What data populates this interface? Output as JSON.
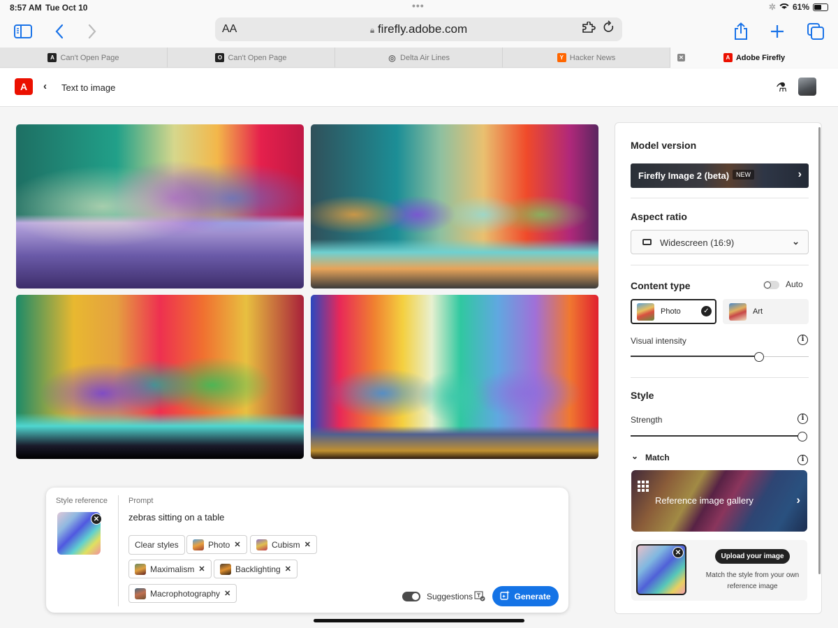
{
  "status": {
    "time": "8:57 AM",
    "date": "Tue Oct 10",
    "battery": "61%",
    "battery_level": 0.61
  },
  "browser": {
    "aa_label": "AA",
    "url": "firefly.adobe.com",
    "tabs": [
      {
        "label": "Can't Open Page",
        "favicon": "A",
        "favicon_color": "#222222"
      },
      {
        "label": "Can't Open Page",
        "favicon": "O",
        "favicon_color": "#222222"
      },
      {
        "label": "Delta Air Lines",
        "favicon": "◎",
        "favicon_color": "#777777"
      },
      {
        "label": "Hacker News",
        "favicon": "Y",
        "favicon_color": "#ff6600"
      },
      {
        "label": "Adobe Firefly",
        "favicon": "A",
        "favicon_color": "#eb1000",
        "active": true
      }
    ]
  },
  "app": {
    "title": "Text to image",
    "logo": "A",
    "brand_color": "#eb1000",
    "accent_color": "#1473e6"
  },
  "images": [
    {
      "alt": "Prismatic paper zebras on a table, teal and red background"
    },
    {
      "alt": "Four origami glass animals with rainbow background"
    },
    {
      "alt": "Holographic zebras on a round reflective table"
    },
    {
      "alt": "Paper zebras in front of a rainbow light curtain"
    }
  ],
  "prompt_bar": {
    "style_reference_label": "Style reference",
    "prompt_label": "Prompt",
    "prompt_text": "zebras sitting on a table",
    "clear_styles": "Clear styles",
    "chips": [
      "Photo",
      "Cubism",
      "Maximalism",
      "Backlighting",
      "Macrophotography"
    ],
    "suggestions_label": "Suggestions",
    "suggestions_on": true,
    "generate_label": "Generate"
  },
  "panel": {
    "model_heading": "Model version",
    "model_name": "Firefly Image 2 (beta)",
    "model_badge": "NEW",
    "aspect_heading": "Aspect ratio",
    "aspect_value": "Widescreen (16:9)",
    "content_heading": "Content type",
    "auto_label": "Auto",
    "auto_on": false,
    "content_options": [
      {
        "label": "Photo",
        "selected": true
      },
      {
        "label": "Art",
        "selected": false
      }
    ],
    "visual_intensity_label": "Visual intensity",
    "visual_intensity_value": 0.74,
    "style_heading": "Style",
    "strength_label": "Strength",
    "strength_value": 1.0,
    "match_label": "Match",
    "gallery_label": "Reference image gallery",
    "upload_label": "Upload your image",
    "upload_desc": "Match the style from your own reference image"
  }
}
